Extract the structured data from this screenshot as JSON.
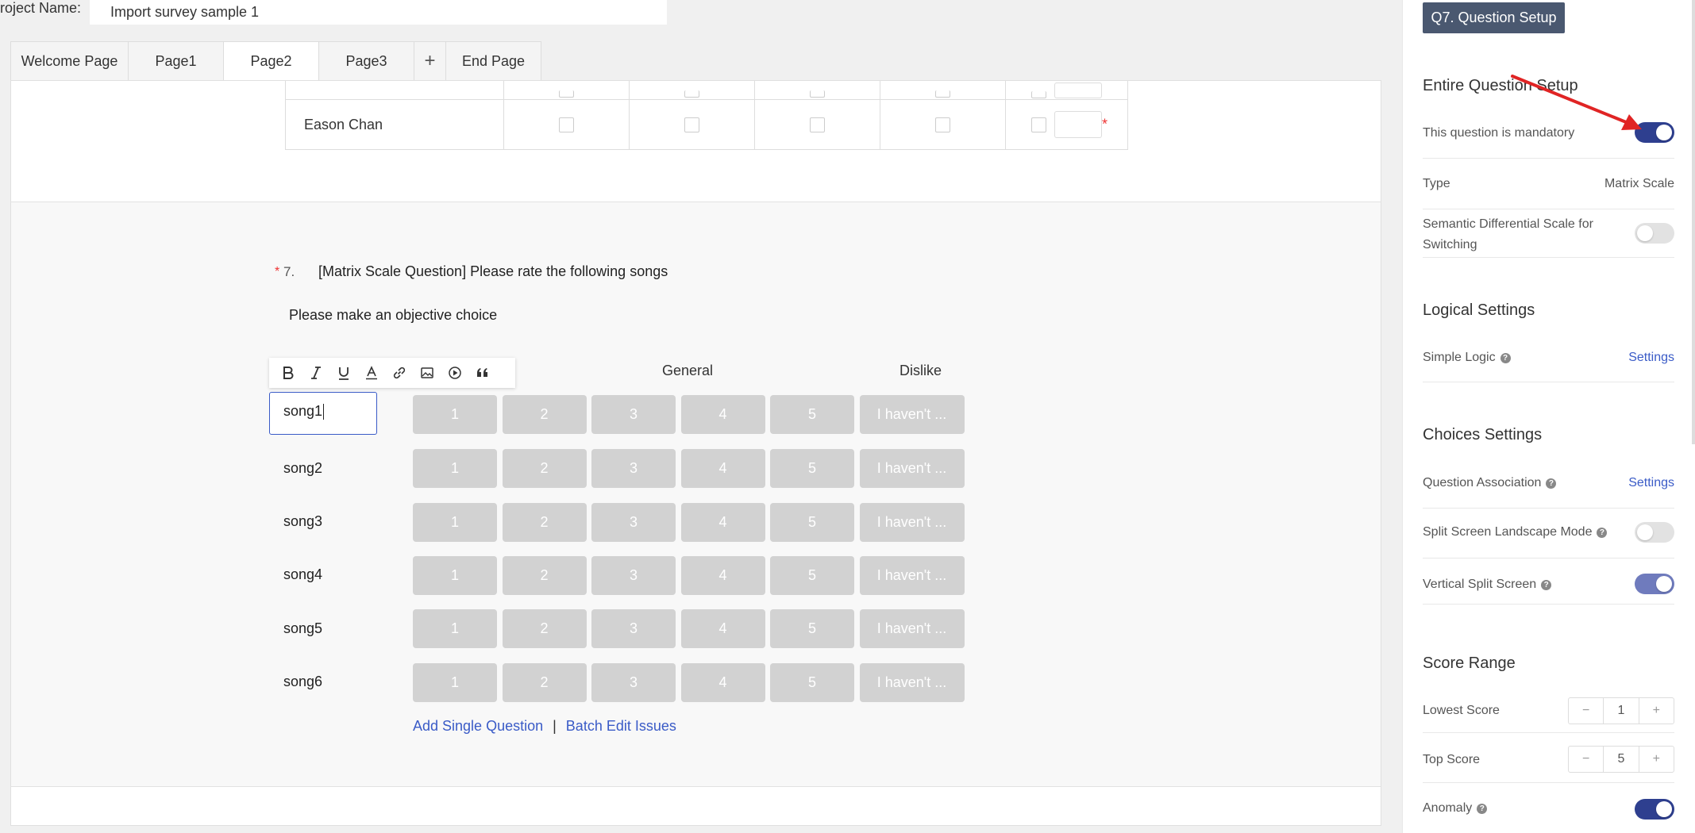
{
  "project": {
    "label": "roject Name:",
    "name": "Import survey sample 1"
  },
  "tabs": [
    {
      "label": "Welcome Page"
    },
    {
      "label": "Page1"
    },
    {
      "label": "Page2"
    },
    {
      "label": "Page3"
    },
    {
      "label": "+"
    },
    {
      "label": "End Page"
    }
  ],
  "previous_question": {
    "row_label": "Eason Chan",
    "required_mark": "*"
  },
  "question": {
    "required_mark": "*",
    "number": "7.",
    "title": "[Matrix Scale Question] Please rate the following songs",
    "description": "Please make an objective choice",
    "column_headers": {
      "middle": "General",
      "right": "Dislike"
    },
    "rows": [
      "song1",
      "song2",
      "song3",
      "song4",
      "song5",
      "song6"
    ],
    "scale_options": [
      "1",
      "2",
      "3",
      "4",
      "5",
      "I haven't ..."
    ],
    "add_single_label": "Add Single Question",
    "separator": "|",
    "batch_edit_label": "Batch Edit Issues"
  },
  "toolbar_icons": [
    "bold-icon",
    "italic-icon",
    "underline-icon",
    "font-color-icon",
    "link-icon",
    "image-icon",
    "video-icon",
    "quote-icon"
  ],
  "panel": {
    "setup_button": "Q7. Question Setup",
    "entire_title": "Entire Question Setup",
    "mandatory_label": "This question is mandatory",
    "mandatory_on": true,
    "type_label": "Type",
    "type_value": "Matrix Scale",
    "semantic_label": "Semantic Differential Scale for Switching",
    "semantic_on": false,
    "logical_title": "Logical Settings",
    "simple_logic_label": "Simple Logic",
    "simple_logic_link": "Settings",
    "choices_title": "Choices Settings",
    "association_label": "Question Association",
    "association_link": "Settings",
    "split_landscape_label": "Split Screen Landscape Mode",
    "split_landscape_on": false,
    "vertical_split_label": "Vertical Split Screen",
    "vertical_split_on": true,
    "score_title": "Score Range",
    "lowest_label": "Lowest Score",
    "lowest_value": "1",
    "top_label": "Top Score",
    "top_value": "5",
    "stepper_minus": "−",
    "stepper_plus": "+",
    "anomaly_label": "Anomaly",
    "anomaly_on": true
  },
  "colors": {
    "accent": "#3a5bc7",
    "toggle_on": "#2e3f8f",
    "setup_button": "#4a5870",
    "scale_button": "#d2d2d2",
    "required": "#e33333",
    "annotation_arrow": "#e02424"
  }
}
